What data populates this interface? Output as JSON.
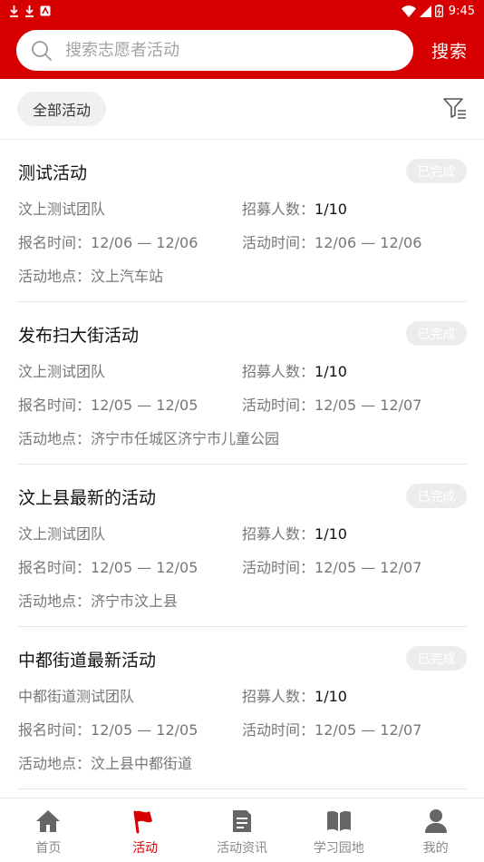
{
  "status_bar": {
    "time": "9:45"
  },
  "search": {
    "placeholder": "搜索志愿者活动",
    "button_label": "搜索"
  },
  "filter": {
    "all_label": "全部活动"
  },
  "labels": {
    "recruit": "招募人数：",
    "signup": "报名时间：",
    "activity_time": "活动时间：",
    "location": "活动地点："
  },
  "activities": [
    {
      "title": "测试活动",
      "status": "已完成",
      "team": "汶上测试团队",
      "recruit": "1/10",
      "signup_time": "12/06 — 12/06",
      "activity_time": "12/06 — 12/06",
      "location": "汶上汽车站"
    },
    {
      "title": "发布扫大街活动",
      "status": "已完成",
      "team": "汶上测试团队",
      "recruit": "1/10",
      "signup_time": "12/05 — 12/05",
      "activity_time": "12/05 — 12/07",
      "location": "济宁市任城区济宁市儿童公园"
    },
    {
      "title": "汶上县最新的活动",
      "status": "已完成",
      "team": "汶上测试团队",
      "recruit": "1/10",
      "signup_time": "12/05 — 12/05",
      "activity_time": "12/05 — 12/07",
      "location": "济宁市汶上县"
    },
    {
      "title": "中都街道最新活动",
      "status": "已完成",
      "team": "中都街道测试团队",
      "recruit": "1/10",
      "signup_time": "12/05 — 12/05",
      "activity_time": "12/05 — 12/07",
      "location": "汶上县中都街道"
    }
  ],
  "bottom_nav": [
    {
      "label": "首页",
      "icon": "home-icon"
    },
    {
      "label": "活动",
      "icon": "flag-icon",
      "active": true
    },
    {
      "label": "活动资讯",
      "icon": "news-icon"
    },
    {
      "label": "学习园地",
      "icon": "book-icon"
    },
    {
      "label": "我的",
      "icon": "user-icon"
    }
  ],
  "colors": {
    "brand": "#d60000",
    "badge_bg": "#ececec",
    "muted_text": "#777777"
  }
}
